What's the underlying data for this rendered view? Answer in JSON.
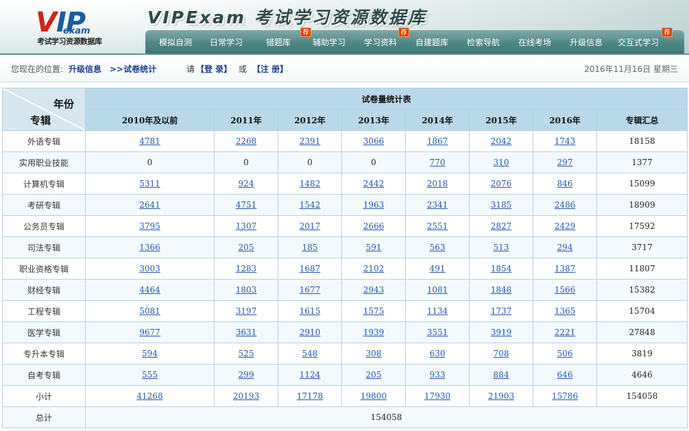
{
  "header": {
    "logo_vip_v": "V",
    "logo_vip_rest": "IP",
    "logo_exam": "exam",
    "logo_subtitle": "考试学习资源数据库",
    "site_title": "VIPExam 考试学习资源数据库",
    "nav": [
      {
        "label": "模拟自测",
        "hot": false
      },
      {
        "label": "日常学习",
        "hot": false
      },
      {
        "label": "错题库",
        "hot": true
      },
      {
        "label": "辅助学习",
        "hot": false
      },
      {
        "label": "学习资料",
        "hot": true
      },
      {
        "label": "自建题库",
        "hot": false
      },
      {
        "label": "检索导航",
        "hot": false
      },
      {
        "label": "在线考场",
        "hot": false
      },
      {
        "label": "升级信息",
        "hot": false
      },
      {
        "label": "交互式学习",
        "hot": true
      }
    ],
    "hot_badge": "荐"
  },
  "location": {
    "prefix": "您现在的位置:",
    "crumb1": "升级信息",
    "crumb2": ">>试卷统计",
    "please": "请",
    "login": "【登 录】",
    "or": "或",
    "register": "【注 册】",
    "date": "2016年11月16日 星期三"
  },
  "table": {
    "title": "试卷量统计表",
    "corner_year": "年份",
    "corner_category": "专辑",
    "columns": [
      "2010年及以前",
      "2011年",
      "2012年",
      "2013年",
      "2014年",
      "2015年",
      "2016年",
      "专辑汇总"
    ],
    "rows": [
      {
        "label": "外语专辑",
        "values": [
          "4781",
          "2268",
          "2391",
          "3066",
          "1867",
          "2042",
          "1743"
        ],
        "links": [
          true,
          true,
          true,
          true,
          true,
          true,
          true
        ],
        "total": "18158"
      },
      {
        "label": "实用职业技能",
        "values": [
          "0",
          "0",
          "0",
          "0",
          "770",
          "310",
          "297"
        ],
        "links": [
          false,
          false,
          false,
          false,
          true,
          true,
          true
        ],
        "total": "1377"
      },
      {
        "label": "计算机专辑",
        "values": [
          "5311",
          "924",
          "1482",
          "2442",
          "2018",
          "2076",
          "846"
        ],
        "links": [
          true,
          true,
          true,
          true,
          true,
          true,
          true
        ],
        "total": "15099"
      },
      {
        "label": "考研专辑",
        "values": [
          "2641",
          "4751",
          "1542",
          "1963",
          "2341",
          "3185",
          "2486"
        ],
        "links": [
          true,
          true,
          true,
          true,
          true,
          true,
          true
        ],
        "total": "18909"
      },
      {
        "label": "公务员专辑",
        "values": [
          "3795",
          "1307",
          "2017",
          "2666",
          "2551",
          "2827",
          "2429"
        ],
        "links": [
          true,
          true,
          true,
          true,
          true,
          true,
          true
        ],
        "total": "17592"
      },
      {
        "label": "司法专辑",
        "values": [
          "1366",
          "205",
          "185",
          "591",
          "563",
          "513",
          "294"
        ],
        "links": [
          true,
          true,
          true,
          true,
          true,
          true,
          true
        ],
        "total": "3717"
      },
      {
        "label": "职业资格专辑",
        "values": [
          "3003",
          "1283",
          "1687",
          "2102",
          "491",
          "1854",
          "1387"
        ],
        "links": [
          true,
          true,
          true,
          true,
          true,
          true,
          true
        ],
        "total": "11807"
      },
      {
        "label": "财经专辑",
        "values": [
          "4464",
          "1803",
          "1677",
          "2943",
          "1081",
          "1848",
          "1566"
        ],
        "links": [
          true,
          true,
          true,
          true,
          true,
          true,
          true
        ],
        "total": "15382"
      },
      {
        "label": "工程专辑",
        "values": [
          "5081",
          "3197",
          "1615",
          "1575",
          "1134",
          "1737",
          "1365"
        ],
        "links": [
          true,
          true,
          true,
          true,
          true,
          true,
          true
        ],
        "total": "15704"
      },
      {
        "label": "医学专辑",
        "values": [
          "9677",
          "3631",
          "2910",
          "1939",
          "3551",
          "3919",
          "2221"
        ],
        "links": [
          true,
          true,
          true,
          true,
          true,
          true,
          true
        ],
        "total": "27848"
      },
      {
        "label": "专升本专辑",
        "values": [
          "594",
          "525",
          "548",
          "308",
          "630",
          "708",
          "506"
        ],
        "links": [
          true,
          true,
          true,
          true,
          true,
          true,
          true
        ],
        "total": "3819"
      },
      {
        "label": "自考专辑",
        "values": [
          "555",
          "299",
          "1124",
          "205",
          "933",
          "884",
          "646"
        ],
        "links": [
          true,
          true,
          true,
          true,
          true,
          true,
          true
        ],
        "total": "4646"
      },
      {
        "label": "小计",
        "values": [
          "41268",
          "20193",
          "17178",
          "19800",
          "17930",
          "21903",
          "15786"
        ],
        "links": [
          true,
          true,
          true,
          true,
          true,
          true,
          true
        ],
        "total": "154058"
      }
    ],
    "grand_total_label": "总计",
    "grand_total_value": "154058"
  }
}
